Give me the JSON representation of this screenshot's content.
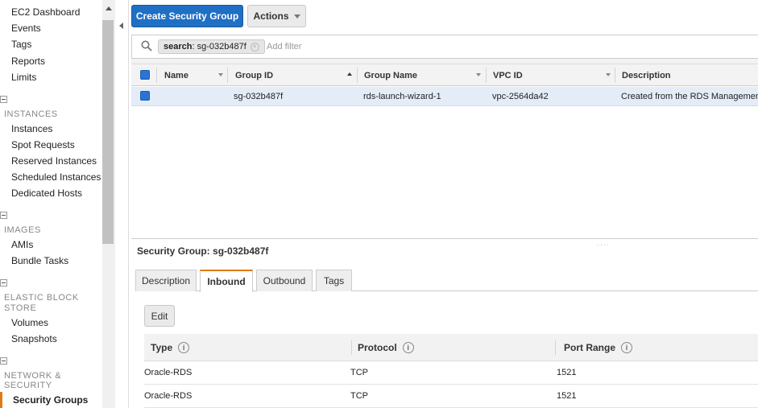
{
  "sidebar": {
    "top_items": [
      {
        "label": "EC2 Dashboard"
      },
      {
        "label": "Events"
      },
      {
        "label": "Tags"
      },
      {
        "label": "Reports"
      },
      {
        "label": "Limits"
      }
    ],
    "sections": [
      {
        "heading": "INSTANCES",
        "items": [
          "Instances",
          "Spot Requests",
          "Reserved Instances",
          "Scheduled Instances",
          "Dedicated Hosts"
        ]
      },
      {
        "heading": "IMAGES",
        "items": [
          "AMIs",
          "Bundle Tasks"
        ]
      },
      {
        "heading_line1": "ELASTIC BLOCK",
        "heading_line2": "STORE",
        "items": [
          "Volumes",
          "Snapshots"
        ]
      },
      {
        "heading_line1": "NETWORK &",
        "heading_line2": "SECURITY",
        "items": [
          "Security Groups"
        ]
      }
    ],
    "active_item": "Security Groups"
  },
  "toolbar": {
    "create_label": "Create Security Group",
    "actions_label": "Actions"
  },
  "filter": {
    "token_key": "search",
    "token_value": ": sg-032b487f",
    "placeholder": "Add filter"
  },
  "table": {
    "columns": [
      "Name",
      "Group ID",
      "Group Name",
      "VPC ID",
      "Description"
    ],
    "rows": [
      {
        "name": "",
        "group_id": "sg-032b487f",
        "group_name": "rds-launch-wizard-1",
        "vpc_id": "vpc-2564da42",
        "description": "Created from the RDS Management"
      }
    ]
  },
  "detail": {
    "title": "Security Group: sg-032b487f",
    "tabs": [
      "Description",
      "Inbound",
      "Outbound",
      "Tags"
    ],
    "active_tab": "Inbound",
    "edit_label": "Edit",
    "rule_columns": [
      "Type",
      "Protocol",
      "Port Range"
    ],
    "rules": [
      {
        "type": "Oracle-RDS",
        "protocol": "TCP",
        "port_range": "1521"
      },
      {
        "type": "Oracle-RDS",
        "protocol": "TCP",
        "port_range": "1521"
      }
    ]
  },
  "colors": {
    "primary_button": "#1f6fc5",
    "active_tab_accent": "#e47911",
    "selected_row": "#e4ecf7",
    "checkbox": "#2d73d2"
  }
}
